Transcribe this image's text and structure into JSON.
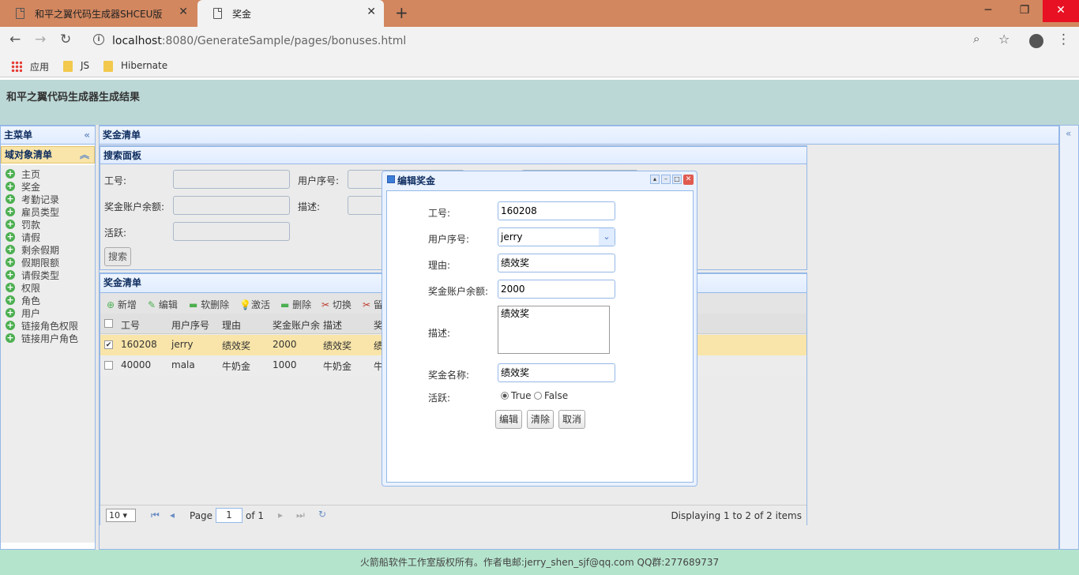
{
  "browser": {
    "tabs": [
      {
        "title": "和平之翼代码生成器SHCEU版"
      },
      {
        "title": "奖金"
      }
    ],
    "url_host": "localhost",
    "url_rest": ":8080/GenerateSample/pages/bonuses.html",
    "bookmarks": [
      {
        "label": "应用"
      },
      {
        "label": "JS"
      },
      {
        "label": "Hibernate"
      }
    ]
  },
  "app": {
    "title": "和平之翼代码生成器生成结果",
    "footer": "火箭船软件工作室版权所有。作者电邮:jerry_shen_sjf@qq.com QQ群:277689737"
  },
  "sidebar": {
    "title": "主菜单",
    "section": "域对象清单",
    "items": [
      "主页",
      "奖金",
      "考勤记录",
      "雇员类型",
      "罚款",
      "请假",
      "剩余假期",
      "假期限额",
      "请假类型",
      "权限",
      "角色",
      "用户",
      "链接角色权限",
      "链接用户角色"
    ]
  },
  "main": {
    "title": "奖金清单",
    "search": {
      "title": "搜索面板",
      "labels": {
        "emp_no": "工号:",
        "user_id": "用户序号:",
        "balance": "奖金账户余额:",
        "desc": "描述:",
        "active": "活跃:"
      },
      "button": "搜索"
    },
    "list": {
      "title": "奖金清单",
      "toolbar": [
        "新增",
        "编辑",
        "软删除",
        "激活",
        "删除",
        "切换",
        "留"
      ],
      "columns": [
        "工号",
        "用户序号",
        "理由",
        "奖金账户余",
        "描述",
        "奖"
      ],
      "rows": [
        {
          "emp_no": "160208",
          "user": "jerry",
          "reason": "绩效奖",
          "balance": "2000",
          "desc": "绩效奖",
          "name": "绩",
          "checked": true
        },
        {
          "emp_no": "40000",
          "user": "mala",
          "reason": "牛奶金",
          "balance": "1000",
          "desc": "牛奶金",
          "name": "牛",
          "checked": false
        }
      ],
      "pager": {
        "page_size": "10",
        "page_label": "Page",
        "page": "1",
        "of": "of 1",
        "summary": "Displaying 1 to 2 of 2 items"
      }
    }
  },
  "dialog": {
    "title": "编辑奖金",
    "fields": {
      "emp_no_label": "工号:",
      "emp_no": "160208",
      "user_label": "用户序号:",
      "user": "jerry",
      "reason_label": "理由:",
      "reason": "绩效奖",
      "balance_label": "奖金账户余额:",
      "balance": "2000",
      "desc_label": "描述:",
      "desc": "绩效奖",
      "name_label": "奖金名称:",
      "name": "绩效奖",
      "active_label": "活跃:",
      "true_label": "True",
      "false_label": "False"
    },
    "buttons": {
      "edit": "编辑",
      "clear": "清除",
      "cancel": "取消"
    }
  }
}
